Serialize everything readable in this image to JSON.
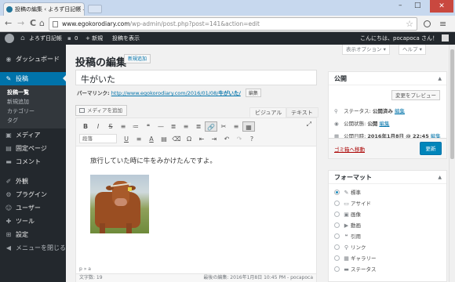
{
  "browser": {
    "tab_title": "投稿の編集 ‹ よろず日記帳 —",
    "url_host": "www.egokorodiary.com",
    "url_path": "/wp-admin/post.php?post=141&action=edit",
    "controls": {
      "back": "←",
      "forward": "→",
      "reload": "C",
      "home": "⌂",
      "star": "☆",
      "menu": "≡",
      "minimize": "–",
      "maximize": "□",
      "close": "✕"
    }
  },
  "admin_bar": {
    "site_name": "よろず日記帳",
    "comments_count": "0",
    "new_label": "+ 新規",
    "view_post": "投稿を表示",
    "greeting": "こんにちは、pocapoca さん！"
  },
  "menu": {
    "items": [
      {
        "label": "ダッシュボード",
        "icon": "dashboard-icon",
        "glyph": "◉"
      },
      {
        "label": "投稿",
        "icon": "pushpin-icon",
        "glyph": "✎",
        "current": true
      },
      {
        "label": "メディア",
        "icon": "media-icon",
        "glyph": "▣"
      },
      {
        "label": "固定ページ",
        "icon": "page-icon",
        "glyph": "▤"
      },
      {
        "label": "コメント",
        "icon": "comment-icon",
        "glyph": "▬"
      },
      {
        "label": "外観",
        "icon": "appearance-icon",
        "glyph": "✐"
      },
      {
        "label": "プラグイン",
        "icon": "plugin-icon",
        "glyph": "⚙"
      },
      {
        "label": "ユーザー",
        "icon": "user-icon",
        "glyph": "☺"
      },
      {
        "label": "ツール",
        "icon": "tools-icon",
        "glyph": "✚"
      },
      {
        "label": "設定",
        "icon": "settings-icon",
        "glyph": "⊞"
      },
      {
        "label": "メニューを閉じる",
        "icon": "collapse-icon",
        "glyph": "◀"
      }
    ],
    "submenu": [
      "投稿一覧",
      "新規追加",
      "カテゴリー",
      "タグ"
    ]
  },
  "screen_options": {
    "options": "表示オプション ▾",
    "help": "ヘルプ ▾"
  },
  "page": {
    "title": "投稿の編集",
    "add_new": "新規追加"
  },
  "post": {
    "title": "牛がいた",
    "permalink_label": "パーマリンク:",
    "permalink_url": "http://www.egokorodiary.com/2016/01/08/",
    "permalink_slug": "牛がいた/",
    "edit_slug": "編集",
    "body_text": "旅行していた時に牛をみかけたんですよ。",
    "path": "p » a",
    "word_count": "文字数: 19",
    "last_edited": "最後の編集: 2016年1月8日 10:45 PM - pocapoca"
  },
  "editor": {
    "add_media": "メディアを追加",
    "tab_visual": "ビジュアル",
    "tab_text": "テキスト",
    "format_select": "段落",
    "row1": [
      "B",
      "I",
      "S",
      "≡",
      "≔",
      "❝",
      "—",
      "≣",
      "≡",
      "≣",
      "🔗",
      "✂",
      "≡",
      "▦"
    ],
    "row2": [
      "U",
      "≡",
      "A",
      "▤",
      "⌫",
      "Ω",
      "⇤",
      "⇥",
      "↶",
      "↷",
      "?"
    ]
  },
  "publish_box": {
    "title": "公開",
    "preview": "変更をプレビュー",
    "status_label": "ステータス:",
    "status_value": "公開済み",
    "visibility_label": "公開状態:",
    "visibility_value": "公開",
    "date_label": "公開日時:",
    "date_value": "2016年1月8日 @ 22:45",
    "edit": "編集",
    "trash": "ゴミ箱へ移動",
    "publish": "更新"
  },
  "format_box": {
    "title": "フォーマット",
    "options": [
      {
        "label": "標準",
        "glyph": "✎",
        "checked": true
      },
      {
        "label": "アサイド",
        "glyph": "▭"
      },
      {
        "label": "画像",
        "glyph": "▣"
      },
      {
        "label": "動画",
        "glyph": "▶"
      },
      {
        "label": "引用",
        "glyph": "❝"
      },
      {
        "label": "リンク",
        "glyph": "⚲"
      },
      {
        "label": "ギャラリー",
        "glyph": "▦"
      },
      {
        "label": "ステータス",
        "glyph": "▬"
      }
    ]
  },
  "colors": {
    "accent": "#0073aa",
    "adminbar": "#23282d",
    "publish": "#0085ba"
  }
}
